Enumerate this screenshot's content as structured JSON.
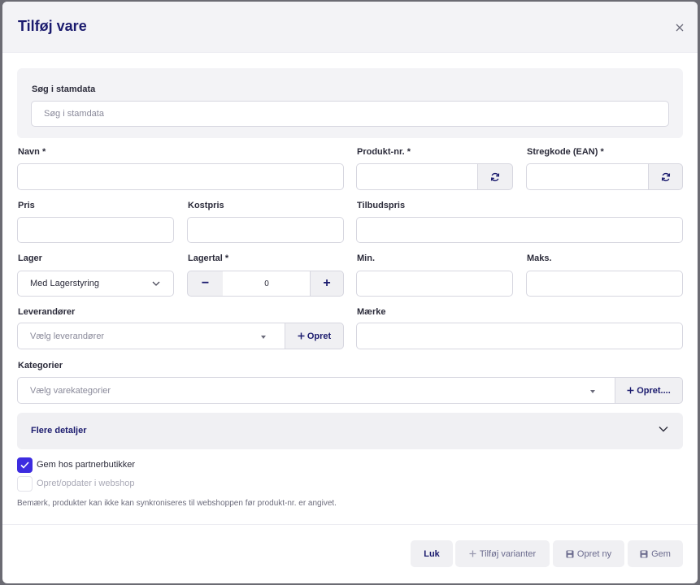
{
  "modal": {
    "title": "Tilføj vare"
  },
  "search": {
    "label": "Søg i stamdata",
    "placeholder": "Søg i stamdata",
    "value": ""
  },
  "fields": {
    "navn": {
      "label": "Navn *",
      "value": ""
    },
    "produkt_nr": {
      "label": "Produkt-nr. *",
      "value": ""
    },
    "stregkode": {
      "label": "Stregkode (EAN) *",
      "value": ""
    },
    "pris": {
      "label": "Pris",
      "value": ""
    },
    "kostpris": {
      "label": "Kostpris",
      "value": ""
    },
    "tilbudspris": {
      "label": "Tilbudspris",
      "value": ""
    },
    "lager": {
      "label": "Lager",
      "value": "Med Lagerstyring"
    },
    "lagertal": {
      "label": "Lagertal *",
      "value": "0",
      "decrement": "−",
      "increment": "+"
    },
    "min": {
      "label": "Min.",
      "value": ""
    },
    "maks": {
      "label": "Maks.",
      "value": ""
    },
    "leverandorer": {
      "label": "Leverandører",
      "placeholder": "Vælg leverandører",
      "create_label": "Opret"
    },
    "maerke": {
      "label": "Mærke",
      "value": ""
    },
    "kategorier": {
      "label": "Kategorier",
      "placeholder": "Vælg varekategorier",
      "create_label": "Opret...."
    }
  },
  "details": {
    "label": "Flere detaljer"
  },
  "checkboxes": [
    {
      "label": "Gem hos partnerbutikker",
      "checked": true
    },
    {
      "label": "Opret/opdater i webshop",
      "checked": false,
      "disabled": true
    }
  ],
  "note": "Bemærk, produkter kan ikke kan synkroniseres til webshoppen før produkt-nr. er angivet.",
  "footer": {
    "close_label": "Luk",
    "add_variants_label": "Tilføj varianter",
    "create_new_label": "Opret ny",
    "save_label": "Gem"
  },
  "colors": {
    "accent": "#3d2ce0",
    "title": "#1b1b6e",
    "panel": "#f3f3f6"
  }
}
